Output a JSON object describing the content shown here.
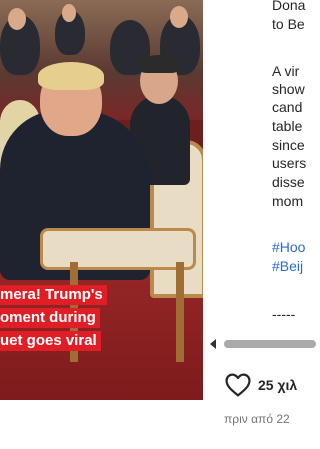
{
  "video": {
    "caption_lines": [
      "mera! Trump's",
      "oment during",
      "uet goes viral"
    ]
  },
  "post_text": {
    "lines": [
      "Dona",
      "to Be",
      "",
      "A vir",
      "show",
      "cand",
      "table",
      "since",
      "users",
      "disse",
      "mom"
    ],
    "hashtags": [
      "#Hoo",
      "#Beij"
    ],
    "separator": "-----"
  },
  "actions": {
    "likes_text": "25 χιλ",
    "time_text": "πριν από 22"
  },
  "colors": {
    "caption_bg": "#e01e26",
    "hashtag": "#2a6ad4"
  }
}
